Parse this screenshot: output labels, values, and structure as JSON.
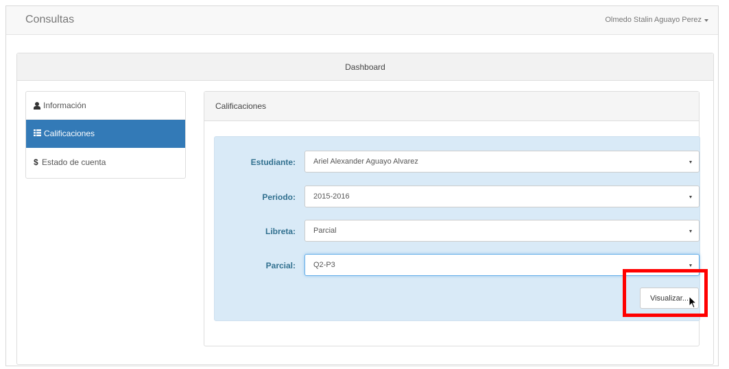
{
  "navbar": {
    "brand": "Consultas",
    "user_name": "Olmedo Stalin Aguayo Perez"
  },
  "dashboard": {
    "title": "Dashboard"
  },
  "sidebar": {
    "items": [
      {
        "label": "Información",
        "icon": "user-icon",
        "active": false
      },
      {
        "label": "Calificaciones",
        "icon": "list-icon",
        "active": true
      },
      {
        "label": "Estado de cuenta",
        "icon": "dollar-icon",
        "active": false
      }
    ]
  },
  "calificaciones": {
    "title": "Calificaciones",
    "fields": [
      {
        "label": "Estudiante:",
        "value": "Ariel Alexander Aguayo Alvarez"
      },
      {
        "label": "Periodo:",
        "value": "2015-2016"
      },
      {
        "label": "Libreta:",
        "value": "Parcial"
      },
      {
        "label": "Parcial:",
        "value": "Q2-P3"
      }
    ],
    "button_label": "Visualizar..."
  },
  "colors": {
    "active_item": "#337ab7",
    "well_background": "#d9eaf7",
    "label_text": "#31708f",
    "highlight_box": "#ff0000"
  }
}
